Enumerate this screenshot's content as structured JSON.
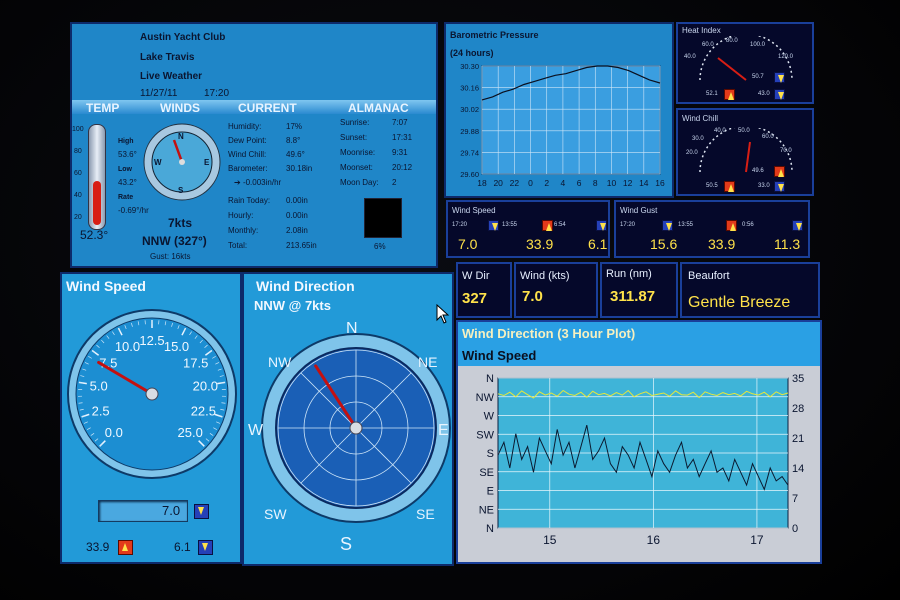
{
  "summary": {
    "club": "Austin Yacht Club",
    "location": "Lake Travis",
    "subtitle": "Live Weather",
    "date": "11/27/11",
    "time": "17:20",
    "headers": {
      "temp": "TEMP",
      "winds": "WINDS",
      "current": "CURRENT",
      "almanac": "ALMANAC"
    },
    "temp": {
      "scale": [
        "100",
        "80",
        "60",
        "40",
        "20"
      ],
      "value": "52.3°",
      "high_label": "High",
      "high": "53.6°",
      "low_label": "Low",
      "low": "43.2°",
      "rate_label": "Rate",
      "rate": "-0.69°/hr",
      "fill_fraction": 0.4
    },
    "winds": {
      "speed": "7kts",
      "dir": "NNW (327°)",
      "gust": "Gust: 16kts",
      "compass": [
        "N",
        "E",
        "S",
        "W"
      ]
    },
    "current": [
      {
        "label": "Humidity:",
        "value": "17%"
      },
      {
        "label": "Dew Point:",
        "value": "8.8°"
      },
      {
        "label": "Wind Chill:",
        "value": "49.6°"
      },
      {
        "label": "Barometer:",
        "value": "30.18in"
      },
      {
        "label": "",
        "value": "-0.003in/hr"
      }
    ],
    "rain": [
      {
        "label": "Rain Today:",
        "value": "0.00in"
      },
      {
        "label": "Hourly:",
        "value": "0.00in"
      },
      {
        "label": "Monthly:",
        "value": "2.08in"
      },
      {
        "label": "Total:",
        "value": "213.65in"
      }
    ],
    "almanac": [
      {
        "label": "Sunrise:",
        "value": "7:07"
      },
      {
        "label": "Sunset:",
        "value": "17:31"
      },
      {
        "label": "Moonrise:",
        "value": "9:31"
      },
      {
        "label": "Moonset:",
        "value": "20:12"
      },
      {
        "label": "Moon Day:",
        "value": "2"
      }
    ],
    "moon_pct": "6%"
  },
  "baro": {
    "title": "Barometric Pressure",
    "subtitle": "(24 hours)"
  },
  "heat_index": {
    "title": "Heat Index",
    "scale": [
      "40.0",
      "60.0",
      "80.0",
      "100.0",
      "120.0"
    ],
    "current": "50.7",
    "high": "52.1",
    "low": "43.0"
  },
  "wind_chill": {
    "title": "Wind Chill",
    "scale": [
      "20.0",
      "30.0",
      "40.0",
      "50.0",
      "60.0",
      "70.0"
    ],
    "current": "49.6",
    "high": "50.5",
    "low": "33.0"
  },
  "wind_speed_mini": {
    "title": "Wind Speed",
    "time": "17:20",
    "t1": "13:55",
    "t2": "6:54",
    "current": "7.0",
    "high": "33.9",
    "low": "6.1"
  },
  "wind_gust_mini": {
    "title": "Wind Gust",
    "time": "17:20",
    "t1": "13:55",
    "t2": "0:56",
    "current": "15.6",
    "high": "33.9",
    "low": "11.3"
  },
  "stats": [
    {
      "label": "W Dir",
      "value": "327"
    },
    {
      "label": "Wind (kts)",
      "value": "7.0"
    },
    {
      "label": "Run (nm)",
      "value": "311.87"
    }
  ],
  "beaufort": {
    "label": "Beaufort",
    "value": "Gentle Breeze"
  },
  "wind_gauge": {
    "title": "Wind Speed",
    "ticks": [
      "0.0",
      "2.5",
      "5.0",
      "7.5",
      "10.0",
      "12.5",
      "15.0",
      "17.5",
      "20.0",
      "22.5",
      "25.0"
    ],
    "current": "7.0",
    "high": "33.9",
    "low": "6.1",
    "needle_value": 7.0
  },
  "wind_dir_gauge": {
    "title": "Wind Direction",
    "subtitle": "NNW @ 7kts",
    "labels": [
      "N",
      "NE",
      "E",
      "SE",
      "S",
      "SW",
      "W",
      "NW"
    ],
    "needle_deg": 327
  },
  "plot": {
    "title": "Wind Direction  (3 Hour Plot)",
    "subtitle": "Wind Speed"
  },
  "chart_data": [
    {
      "type": "line",
      "title": "Barometric Pressure",
      "subtitle": "(24 hours)",
      "x": [
        "18",
        "20",
        "22",
        "0",
        "2",
        "4",
        "6",
        "8",
        "10",
        "12",
        "14",
        "16"
      ],
      "ylim": [
        29.6,
        30.3
      ],
      "yticks": [
        "30.30",
        "30.16",
        "30.02",
        "29.88",
        "29.74",
        "29.60"
      ],
      "series": [
        {
          "values": [
            30.08,
            30.1,
            30.13,
            30.15,
            30.18,
            30.2,
            30.22,
            30.24,
            30.25,
            30.27,
            30.29,
            30.3,
            30.3,
            30.29,
            30.27,
            30.24,
            30.21,
            30.19
          ]
        }
      ],
      "grid": true
    },
    {
      "type": "line",
      "title": "Wind Direction  (3 Hour Plot)",
      "subtitle": "Wind Speed",
      "x": [
        "15",
        "16",
        "17"
      ],
      "xlim": [
        14.5,
        17.3
      ],
      "y_left_ticks": [
        "N",
        "NW",
        "W",
        "SW",
        "S",
        "SE",
        "E",
        "NE",
        "N"
      ],
      "y_right_ticks": [
        "35",
        "28",
        "21",
        "14",
        "7",
        "0"
      ],
      "ylim_right": [
        0,
        35
      ],
      "series": [
        {
          "axis": "left",
          "color": "#e6e83a",
          "values": [
            322,
            318,
            326,
            315,
            329,
            320,
            312,
            327,
            319,
            324,
            316,
            330,
            321,
            318,
            326,
            314,
            328,
            320,
            323,
            317,
            325,
            319,
            330,
            315,
            322,
            327,
            318,
            321,
            324,
            316,
            329,
            320,
            319,
            326,
            313,
            327,
            321,
            318,
            325,
            320,
            323,
            317,
            328,
            322,
            319,
            326,
            315,
            327,
            320,
            324
          ]
        },
        {
          "axis": "right",
          "color": "#0a1a30",
          "values": [
            17,
            20,
            14,
            22,
            16,
            19,
            13,
            21,
            18,
            15,
            23,
            17,
            20,
            14,
            19,
            24,
            16,
            18,
            21,
            15,
            13,
            19,
            17,
            14,
            20,
            16,
            12,
            18,
            15,
            13,
            17,
            20,
            14,
            16,
            12,
            15,
            18,
            13,
            14,
            11,
            16,
            13,
            10,
            15,
            12,
            9,
            14,
            11,
            12,
            10
          ]
        }
      ],
      "grid": true
    }
  ]
}
